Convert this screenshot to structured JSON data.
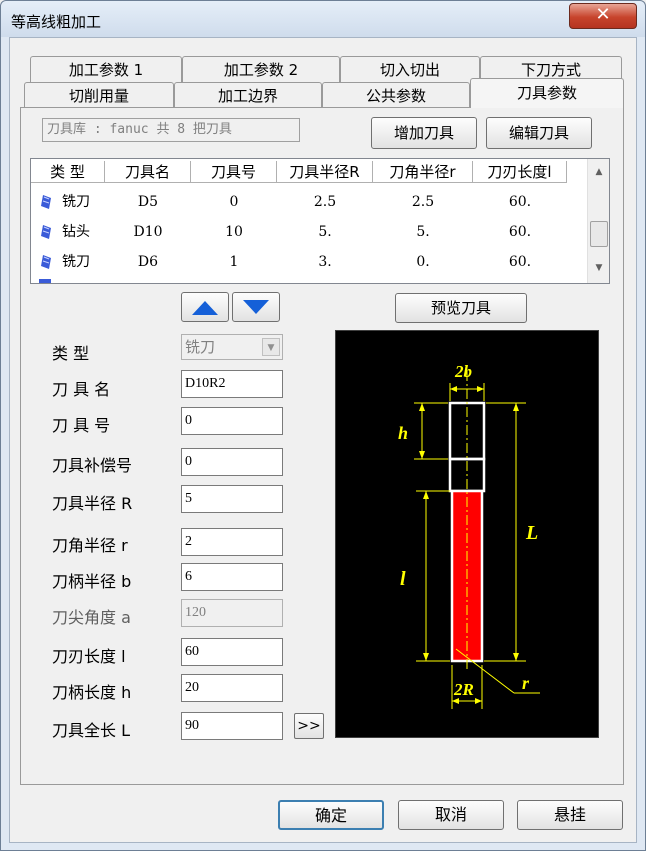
{
  "window": {
    "title": "等高线粗加工",
    "close_glyph": "✕"
  },
  "tabs_row1": [
    "加工参数 1",
    "加工参数 2",
    "切入切出",
    "下刀方式"
  ],
  "tabs_row2": [
    "切削用量",
    "加工边界",
    "公共参数",
    "刀具参数"
  ],
  "active_tab": "刀具参数",
  "library": {
    "text": "刀具库 : fanuc   共 8 把刀具",
    "add_button": "增加刀具",
    "edit_button": "编辑刀具"
  },
  "tool_list": {
    "headers": [
      "类 型",
      "刀具名",
      "刀具号",
      "刀具半径R",
      "刀角半径r",
      "刀刃长度l"
    ],
    "rows": [
      {
        "type": "铣刀",
        "name": "D5",
        "number": "0",
        "R": "2.5",
        "r": "2.5",
        "l": "60."
      },
      {
        "type": "钻头",
        "name": "D10",
        "number": "10",
        "R": "5.",
        "r": "5.",
        "l": "60."
      },
      {
        "type": "铣刀",
        "name": "D6",
        "number": "1",
        "R": "3.",
        "r": "0.",
        "l": "60."
      }
    ],
    "icon": "tool-blue-icon"
  },
  "preview_button": "预览刀具",
  "form": {
    "type_label": "类     型",
    "type_value": "铣刀",
    "name_label": "刀 具 名",
    "name_value": "D10R2",
    "number_label": "刀 具 号",
    "number_value": "0",
    "comp_label": "刀具补偿号",
    "comp_value": "0",
    "radius_label": "刀具半径 R",
    "radius_value": "5",
    "corner_label": "刀角半径 r",
    "corner_value": "2",
    "shank_radius_label": "刀柄半径 b",
    "shank_radius_value": "6",
    "tip_angle_label": "刀尖角度 a",
    "tip_angle_value": "120",
    "blade_length_label": "刀刃长度 l",
    "blade_length_value": "60",
    "shank_length_label": "刀柄长度 h",
    "shank_length_value": "20",
    "total_length_label": "刀具全长 L",
    "total_length_value": "90",
    "more_button": ">>"
  },
  "diagram": {
    "label_2b": "2b",
    "label_h": "h",
    "label_L": "L",
    "label_l": "l",
    "label_2R": "2R",
    "label_r": "r",
    "dim_color": "#ffff00",
    "blade_color": "#ff0000"
  },
  "buttons": {
    "ok": "确定",
    "cancel": "取消",
    "suspend": "悬挂"
  }
}
